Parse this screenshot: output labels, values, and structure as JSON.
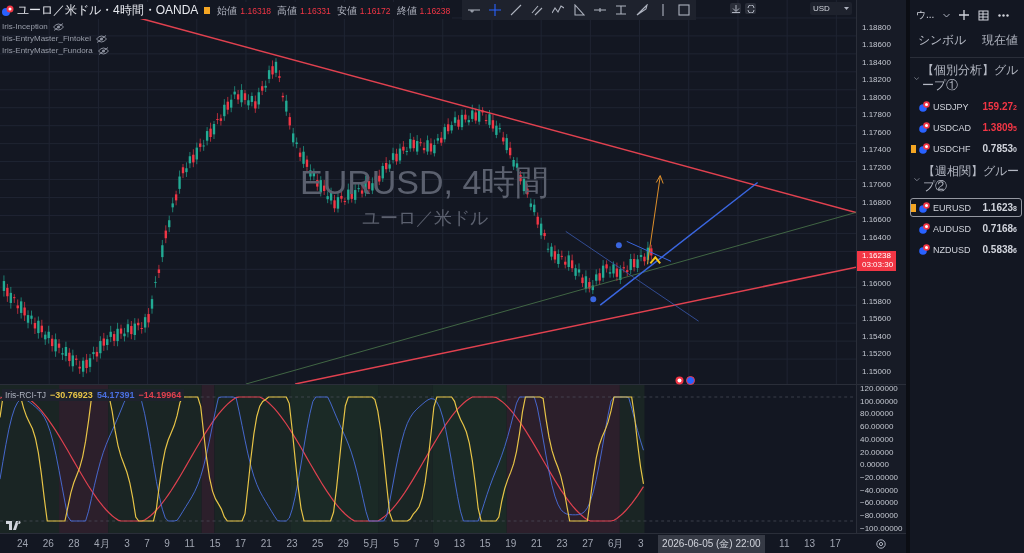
{
  "legend": {
    "title": "ユーロ／米ドル・4時間・OANDA",
    "ohlc": [
      {
        "label": "始値",
        "value": "1.16318"
      },
      {
        "label": "高値",
        "value": "1.16331"
      },
      {
        "label": "安値",
        "value": "1.16172"
      },
      {
        "label": "終値",
        "value": "1.16238"
      }
    ],
    "indicators": [
      "Iris-Inception",
      "Iris-EntryMaster_Fintokei",
      "Iris-EntryMaster_Fundora"
    ]
  },
  "currency_select": "USD",
  "watermark": {
    "symbol": "EURUSD, 4時間",
    "description": "ユーロ／米ドル"
  },
  "price_axis": [
    "1.18800",
    "1.18600",
    "1.18400",
    "1.18200",
    "1.18000",
    "1.17800",
    "1.17600",
    "1.17400",
    "1.17200",
    "1.17000",
    "1.16800",
    "1.16600",
    "1.16400",
    "1.16000",
    "1.15800",
    "1.15600",
    "1.15400",
    "1.15200",
    "1.15000"
  ],
  "last_price": {
    "price": "1.16238",
    "countdown": "03:03:30"
  },
  "oscillator": {
    "name": "Iris-RCI-TJ",
    "values": [
      {
        "value": "−30.76923",
        "color": "#e8c547"
      },
      {
        "value": "54.17391",
        "color": "#4a6fe0"
      },
      {
        "value": "−14.19964",
        "color": "#e0414f"
      }
    ],
    "axis": [
      "120.00000",
      "100.00000",
      "80.00000",
      "60.00000",
      "40.00000",
      "20.00000",
      "0.00000",
      "−20.00000",
      "−40.00000",
      "−60.00000",
      "−80.00000",
      "−100.00000"
    ]
  },
  "time_axis": {
    "labels": [
      "24",
      "26",
      "28",
      "4月",
      "3",
      "7",
      "9",
      "11",
      "15",
      "17",
      "21",
      "23",
      "25",
      "29",
      "5月",
      "5",
      "7",
      "9",
      "13",
      "15",
      "19",
      "21",
      "23",
      "27",
      "6月",
      "3",
      "11",
      "13",
      "17"
    ],
    "cursor": "2026-06-05 (金)  22:00"
  },
  "watchlist": {
    "title": "ウ...",
    "columns": [
      "シンボル",
      "現在値"
    ],
    "groups": [
      {
        "name": "【個別分析】グループ①",
        "expanded": true,
        "items": [
          {
            "symbol": "USDJPY",
            "price": "159.27",
            "pip": "2",
            "color": "#f23645",
            "flagged": false,
            "selected": false
          },
          {
            "symbol": "USDCAD",
            "price": "1.3809",
            "pip": "5",
            "color": "#f23645",
            "flagged": false,
            "selected": false
          },
          {
            "symbol": "USDCHF",
            "price": "0.7853",
            "pip": "0",
            "color": "#d1d4dc",
            "flagged": true,
            "selected": false
          }
        ]
      },
      {
        "name": "【週相関】グループ②",
        "expanded": true,
        "items": [
          {
            "symbol": "EURUSD",
            "price": "1.1623",
            "pip": "8",
            "color": "#d1d4dc",
            "flagged": true,
            "selected": true
          },
          {
            "symbol": "AUDUSD",
            "price": "0.7168",
            "pip": "6",
            "color": "#d1d4dc",
            "flagged": false,
            "selected": false
          },
          {
            "symbol": "NZDUSD",
            "price": "0.5838",
            "pip": "6",
            "color": "#d1d4dc",
            "flagged": false,
            "selected": false
          }
        ]
      }
    ]
  }
}
